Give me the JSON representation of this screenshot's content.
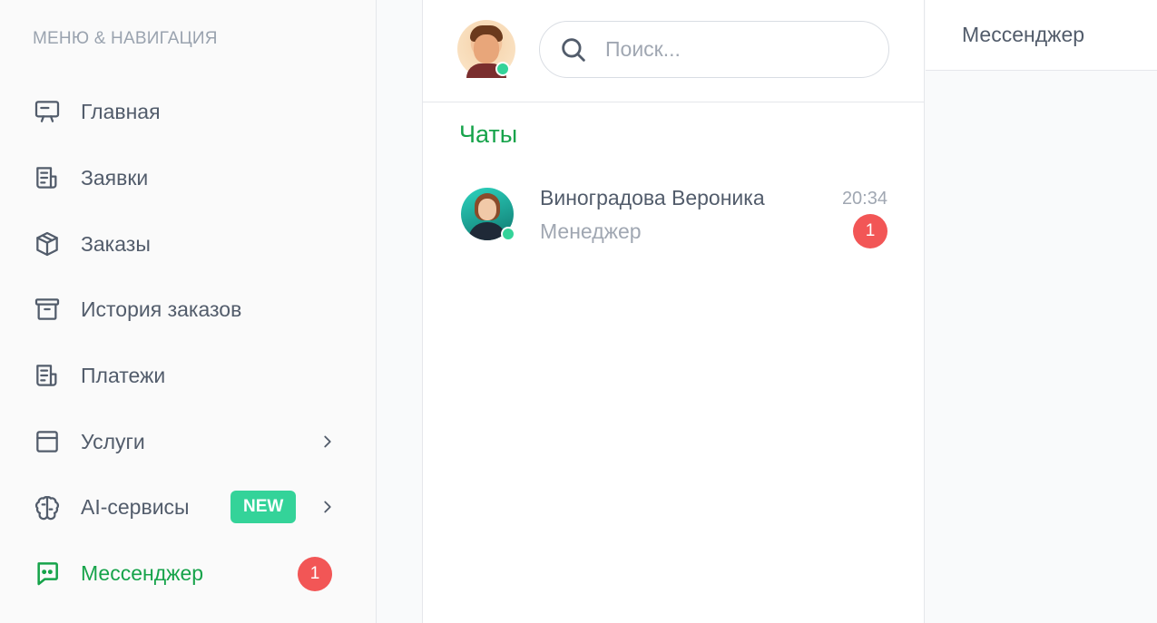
{
  "sidebar": {
    "heading": "МЕНЮ & НАВИГАЦИЯ",
    "items": [
      {
        "label": "Главная",
        "icon": "presentation-icon"
      },
      {
        "label": "Заявки",
        "icon": "document-icon"
      },
      {
        "label": "Заказы",
        "icon": "box-icon"
      },
      {
        "label": "История заказов",
        "icon": "archive-icon"
      },
      {
        "label": "Платежи",
        "icon": "receipt-icon"
      },
      {
        "label": "Услуги",
        "icon": "window-icon"
      },
      {
        "label": "AI-сервисы",
        "icon": "brain-icon",
        "badge": "NEW"
      },
      {
        "label": "Мессенджер",
        "icon": "chat-icon",
        "count": "1",
        "active": true
      }
    ]
  },
  "chat_list": {
    "search_placeholder": "Поиск...",
    "section_title": "Чаты",
    "chats": [
      {
        "name": "Виноградова Вероника",
        "role": "Менеджер",
        "time": "20:34",
        "unread": "1"
      }
    ]
  },
  "conversation": {
    "title": "Мессенджер"
  },
  "colors": {
    "accent": "#16a34a",
    "badge_new": "#34d399",
    "unread": "#f25656",
    "online": "#34d399"
  }
}
